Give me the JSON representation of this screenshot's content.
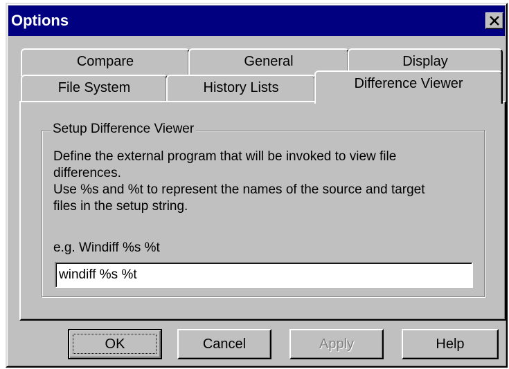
{
  "window": {
    "title": "Options",
    "close_glyph": "✕"
  },
  "tabs": {
    "back_row": [
      {
        "label": "Compare"
      },
      {
        "label": "General"
      },
      {
        "label": "Display"
      }
    ],
    "front_row": [
      {
        "label": "File System"
      },
      {
        "label": "History Lists"
      },
      {
        "label": "Difference Viewer",
        "selected": true
      }
    ]
  },
  "group": {
    "legend": "Setup Difference Viewer",
    "line1": "Define the external program that will be invoked to view file",
    "line2": "differences.",
    "line3": "Use %s and %t to represent the names of the source and target",
    "line4": "files in the setup string.",
    "example": "e.g. Windiff %s %t",
    "setup_value": "windiff %s %t"
  },
  "buttons": {
    "ok": "OK",
    "cancel": "Cancel",
    "apply": "Apply",
    "apply_enabled": false,
    "help": "Help"
  },
  "colors": {
    "titlebar": "#000080",
    "face": "#c0c0c0",
    "disabled_text": "#808080"
  },
  "icons": {
    "close": "close-icon"
  }
}
